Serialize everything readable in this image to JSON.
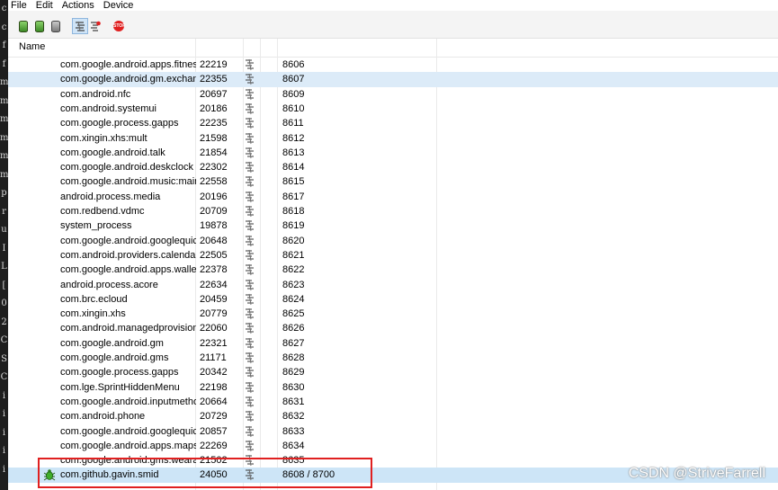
{
  "left_strip_chars": [
    "c",
    "c",
    "f",
    "f",
    "m",
    "m",
    "m",
    "m",
    "m",
    "m",
    "p",
    "r",
    "u",
    "I",
    "L",
    "[",
    "0",
    "2",
    "C",
    "S",
    "C",
    "i",
    "i",
    "i",
    "i",
    "i"
  ],
  "menu": [
    "File",
    "Edit",
    "Actions",
    "Device"
  ],
  "toolbar": {
    "buttons": [
      {
        "name": "debug-process-icon",
        "color": "#4caf50"
      },
      {
        "name": "update-heap-icon",
        "color": "#4caf50"
      },
      {
        "name": "dump-hprof-icon",
        "color": "#9e9e9e"
      },
      {
        "name": "update-threads-icon",
        "color": "#5a5a5a"
      },
      {
        "name": "start-method-profiling-icon",
        "color": "#e02020"
      },
      {
        "name": "stop-process-icon",
        "color": "#e02020"
      }
    ],
    "stop_label": "STOP"
  },
  "table": {
    "header_name": "Name",
    "rows": [
      {
        "name": "com.google.android.apps.fitness",
        "pid": "22219",
        "port": "8606"
      },
      {
        "name": "com.google.android.gm.exchange",
        "pid": "22355",
        "port": "8607"
      },
      {
        "name": "com.android.nfc",
        "pid": "20697",
        "port": "8609"
      },
      {
        "name": "com.android.systemui",
        "pid": "20186",
        "port": "8610"
      },
      {
        "name": "com.google.process.gapps",
        "pid": "22235",
        "port": "8611"
      },
      {
        "name": "com.xingin.xhs:mult",
        "pid": "21598",
        "port": "8612"
      },
      {
        "name": "com.google.android.talk",
        "pid": "21854",
        "port": "8613"
      },
      {
        "name": "com.google.android.deskclock",
        "pid": "22302",
        "port": "8614"
      },
      {
        "name": "com.google.android.music:main",
        "pid": "22558",
        "port": "8615"
      },
      {
        "name": "android.process.media",
        "pid": "20196",
        "port": "8617"
      },
      {
        "name": "com.redbend.vdmc",
        "pid": "20709",
        "port": "8618"
      },
      {
        "name": "system_process",
        "pid": "19878",
        "port": "8619"
      },
      {
        "name": "com.google.android.googlequicksearchbox",
        "pid": "20648",
        "port": "8620"
      },
      {
        "name": "com.android.providers.calendar",
        "pid": "22505",
        "port": "8621"
      },
      {
        "name": "com.google.android.apps.wallet",
        "pid": "22378",
        "port": "8622"
      },
      {
        "name": "android.process.acore",
        "pid": "22634",
        "port": "8623"
      },
      {
        "name": "com.brc.ecloud",
        "pid": "20459",
        "port": "8624"
      },
      {
        "name": "com.xingin.xhs",
        "pid": "20779",
        "port": "8625"
      },
      {
        "name": "com.android.managedprovisioning",
        "pid": "22060",
        "port": "8626"
      },
      {
        "name": "com.google.android.gm",
        "pid": "22321",
        "port": "8627"
      },
      {
        "name": "com.google.android.gms",
        "pid": "21171",
        "port": "8628"
      },
      {
        "name": "com.google.process.gapps",
        "pid": "20342",
        "port": "8629"
      },
      {
        "name": "com.lge.SprintHiddenMenu",
        "pid": "22198",
        "port": "8630"
      },
      {
        "name": "com.google.android.inputmethod",
        "pid": "20664",
        "port": "8631"
      },
      {
        "name": "com.android.phone",
        "pid": "20729",
        "port": "8632"
      },
      {
        "name": "com.google.android.googlequicksearchbox",
        "pid": "20857",
        "port": "8633"
      },
      {
        "name": "com.google.android.apps.maps",
        "pid": "22269",
        "port": "8634"
      },
      {
        "name": "com.google.android.gms.wearable",
        "pid": "21502",
        "port": "8635"
      },
      {
        "name": "com.github.gavin.smid",
        "pid": "24050",
        "port": "8608 / 8700",
        "debug": true
      }
    ]
  },
  "selected_row_index": 1,
  "watermark": "CSDN @StriveFarrell",
  "colors": {
    "highlight": "#e02020",
    "selection": "#dcebf8"
  }
}
